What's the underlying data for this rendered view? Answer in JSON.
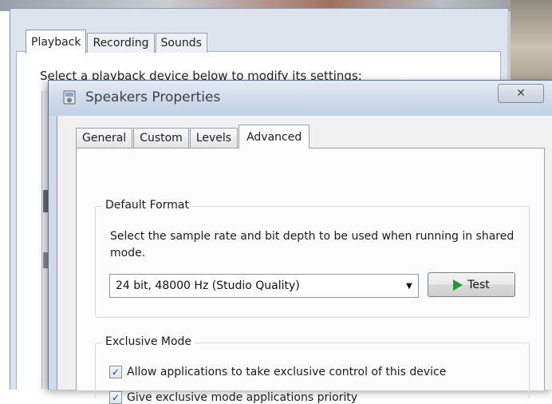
{
  "back_dialog": {
    "tabs": [
      {
        "label": "Playback",
        "active": true
      },
      {
        "label": "Recording",
        "active": false
      },
      {
        "label": "Sounds",
        "active": false
      }
    ],
    "instruction": "Select a playback device below to modify its settings:"
  },
  "dialog": {
    "title": "Speakers Properties",
    "close_symbol": "✕",
    "tabs": [
      {
        "label": "General",
        "active": false
      },
      {
        "label": "Custom",
        "active": false
      },
      {
        "label": "Levels",
        "active": false
      },
      {
        "label": "Advanced",
        "active": true
      }
    ],
    "default_format": {
      "legend": "Default Format",
      "description": "Select the sample rate and bit depth to be used when running in shared mode.",
      "selected_format": "24 bit, 48000 Hz (Studio Quality)",
      "test_label": "Test"
    },
    "exclusive_mode": {
      "legend": "Exclusive Mode",
      "allow_label": "Allow applications to take exclusive control of this device",
      "allow_checked": true,
      "priority_label": "Give exclusive mode applications priority",
      "priority_checked": true
    }
  },
  "icons": {
    "title": "speaker-properties-icon",
    "play": "play-icon",
    "dropdown": "chevron-down-icon",
    "check": "checkmark-icon"
  },
  "colors": {
    "play_icon": "#1d9a33",
    "titlebar": "#cedaea",
    "checkmark": "#1e3c8a"
  }
}
